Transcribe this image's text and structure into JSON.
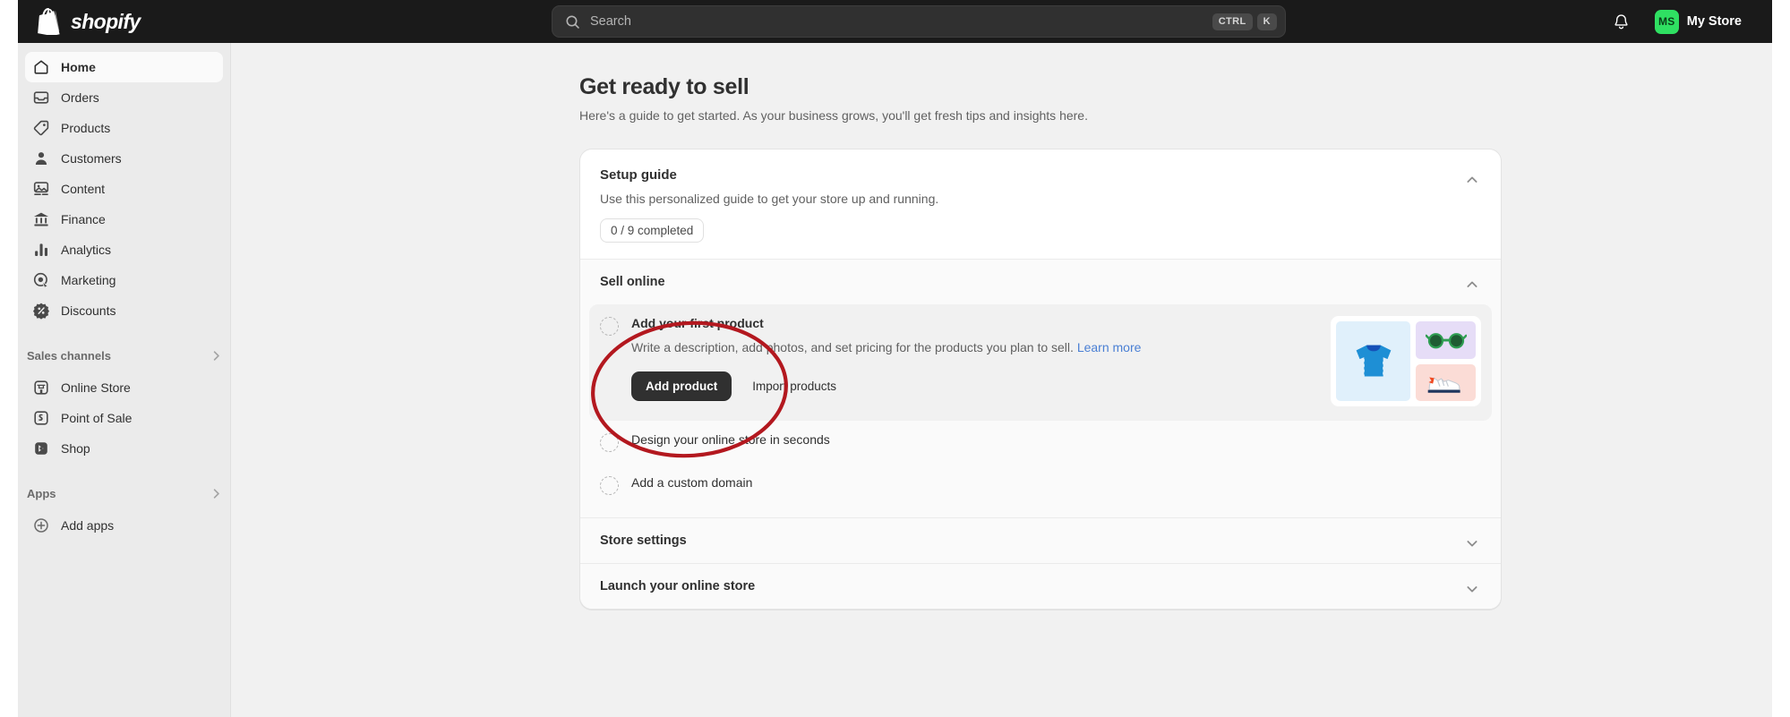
{
  "topbar": {
    "brand": "shopify",
    "brand_icon": "shopify-bag-icon",
    "search": {
      "placeholder": "Search",
      "icon": "search-icon",
      "shortcut_keys": [
        "CTRL",
        "K"
      ]
    },
    "notifications_icon": "bell-icon",
    "store": {
      "initials": "MS",
      "name": "My Store",
      "avatar_color": "#2fe062"
    }
  },
  "sidebar": {
    "items": [
      {
        "label": "Home",
        "icon": "home-icon",
        "active": true
      },
      {
        "label": "Orders",
        "icon": "orders-icon",
        "active": false
      },
      {
        "label": "Products",
        "icon": "products-tag-icon",
        "active": false
      },
      {
        "label": "Customers",
        "icon": "customers-person-icon",
        "active": false
      },
      {
        "label": "Content",
        "icon": "content-image-icon",
        "active": false
      },
      {
        "label": "Finance",
        "icon": "finance-bank-icon",
        "active": false
      },
      {
        "label": "Analytics",
        "icon": "analytics-bars-icon",
        "active": false
      },
      {
        "label": "Marketing",
        "icon": "marketing-target-icon",
        "active": false
      },
      {
        "label": "Discounts",
        "icon": "discounts-percent-icon",
        "active": false
      }
    ],
    "groups": [
      {
        "label": "Sales channels",
        "chevron": "chevron-right-icon",
        "items": [
          {
            "label": "Online Store",
            "icon": "online-store-icon"
          },
          {
            "label": "Point of Sale",
            "icon": "point-of-sale-icon"
          },
          {
            "label": "Shop",
            "icon": "shop-icon"
          }
        ]
      },
      {
        "label": "Apps",
        "chevron": "chevron-right-icon",
        "items": [
          {
            "label": "Add apps",
            "icon": "plus-circle-icon"
          }
        ]
      }
    ]
  },
  "main": {
    "title": "Get ready to sell",
    "subtitle": "Here's a guide to get started. As your business grows, you'll get fresh tips and insights here.",
    "setup_guide": {
      "title": "Setup guide",
      "description": "Use this personalized guide to get your store up and running.",
      "progress": "0 / 9 completed",
      "collapse_icon": "chevron-up-icon"
    },
    "sections": [
      {
        "title": "Sell online",
        "expanded": true,
        "collapse_icon": "chevron-up-icon"
      },
      {
        "title": "Store settings",
        "expanded": false,
        "collapse_icon": "chevron-down-icon"
      },
      {
        "title": "Launch your online store",
        "expanded": false,
        "collapse_icon": "chevron-down-icon"
      }
    ],
    "tasks": [
      {
        "title": "Add your first product",
        "expanded": true,
        "description": "Write a description, add photos, and set pricing for the products you plan to sell. ",
        "learn_more": "Learn more",
        "primary_button": "Add product",
        "secondary_button": "Import products",
        "illustration": {
          "items": [
            "tshirt-icon",
            "sunglasses-icon",
            "sneaker-icon"
          ],
          "colors": [
            "#e0f0fb",
            "#e6ddf7",
            "#fbdcd6"
          ]
        }
      },
      {
        "title": "Design your online store in seconds",
        "expanded": false
      },
      {
        "title": "Add a custom domain",
        "expanded": false
      }
    ]
  },
  "annotation": {
    "shape": "red-ellipse-highlight",
    "color": "#b3181f",
    "target": "Add your first product"
  }
}
